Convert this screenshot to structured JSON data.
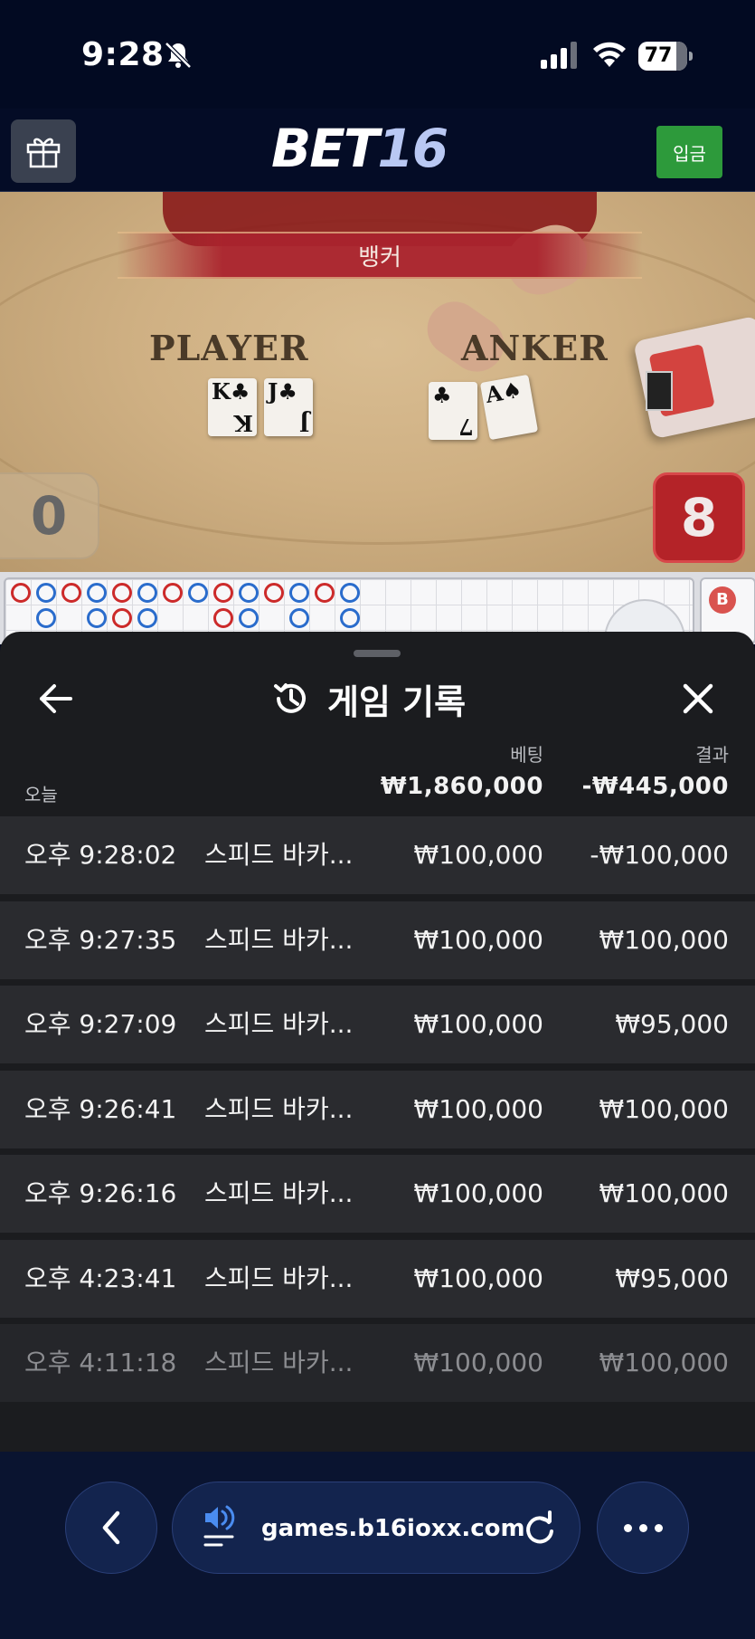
{
  "status_bar": {
    "time": "9:28",
    "battery": "77",
    "icons": [
      "bell-slash-icon",
      "signal-icon",
      "wifi-icon",
      "battery-icon"
    ]
  },
  "app_header": {
    "logo_part1": "BET",
    "logo_part2": "16",
    "deposit_label": "입금",
    "gift_icon": "gift-icon"
  },
  "game_view": {
    "banner_text": "뱅커",
    "player_label": "PLAYER",
    "banker_label": "ANKER",
    "player_score": "0",
    "banker_score": "8",
    "player_cards": [
      {
        "rank": "K",
        "suit": "♣"
      },
      {
        "rank": "J",
        "suit": "♣"
      }
    ],
    "banker_cards": [
      {
        "rank": "7",
        "suit": "♣"
      },
      {
        "rank": "A",
        "suit": "♠"
      }
    ],
    "road_badge": "B"
  },
  "history": {
    "title": "게임 기록",
    "col_bet": "베팅",
    "col_result": "결과",
    "today_label": "오늘",
    "total_bet": "₩1,860,000",
    "total_result": "-₩445,000",
    "rows": [
      {
        "time": "오후 9:28:02",
        "game": "스피드 바카...",
        "bet": "₩100,000",
        "result": "-₩100,000"
      },
      {
        "time": "오후 9:27:35",
        "game": "스피드 바카...",
        "bet": "₩100,000",
        "result": "₩100,000"
      },
      {
        "time": "오후 9:27:09",
        "game": "스피드 바카...",
        "bet": "₩100,000",
        "result": "₩95,000"
      },
      {
        "time": "오후 9:26:41",
        "game": "스피드 바카...",
        "bet": "₩100,000",
        "result": "₩100,000"
      },
      {
        "time": "오후 9:26:16",
        "game": "스피드 바카...",
        "bet": "₩100,000",
        "result": "₩100,000"
      },
      {
        "time": "오후 4:23:41",
        "game": "스피드 바카...",
        "bet": "₩100,000",
        "result": "₩95,000"
      },
      {
        "time": "오후 4:11:18",
        "game": "스피드 바카...",
        "bet": "₩100,000",
        "result": "₩100,000"
      }
    ]
  },
  "browser": {
    "url": "games.b16ioxx.com"
  }
}
